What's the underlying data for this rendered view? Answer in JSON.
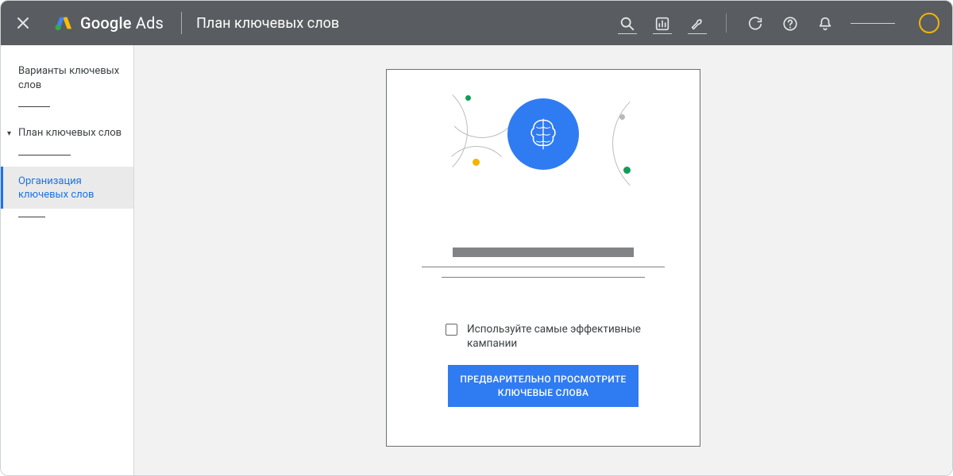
{
  "header": {
    "product_name_bold": "Google",
    "product_name_rest": " Ads",
    "page_title": "План ключевых слов"
  },
  "sidebar": {
    "items": [
      {
        "label": "Варианты ключевых слов"
      },
      {
        "label": "План ключевых слов"
      },
      {
        "label": "Организация ключевых слов"
      }
    ]
  },
  "card": {
    "checkbox_label": "Используйте самые эффективные кампании",
    "preview_button": "Предварительно просмотрите ключевые слова"
  }
}
